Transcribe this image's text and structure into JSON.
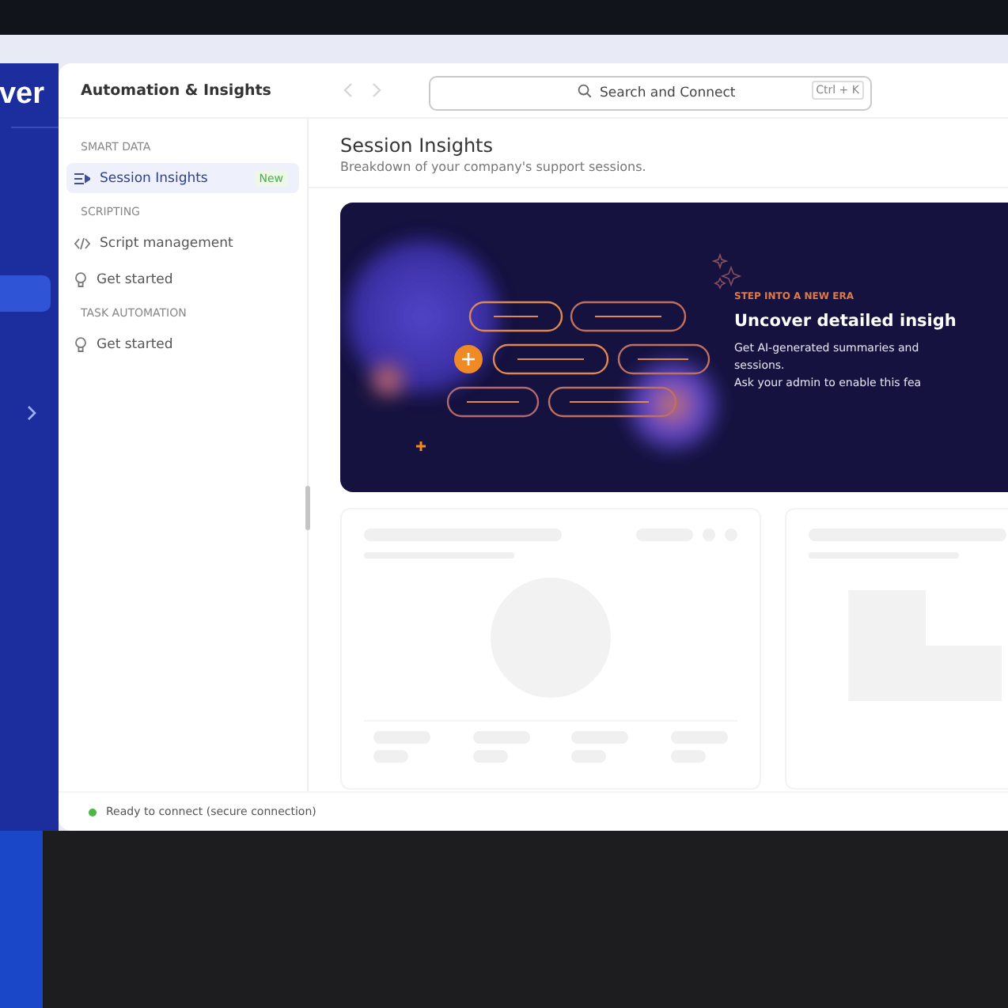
{
  "rail": {
    "logo": "ver"
  },
  "window": {
    "title": "Automation & Insights"
  },
  "search": {
    "placeholder": "Search and Connect",
    "shortcut": "Ctrl + K"
  },
  "sidebar": {
    "sections": [
      {
        "heading": "SMART DATA",
        "items": [
          {
            "kind": "list",
            "label": "Session Insights",
            "badge": "New",
            "selected": true
          }
        ]
      },
      {
        "heading": "SCRIPTING",
        "items": [
          {
            "kind": "code",
            "label": "Script management",
            "selected": false
          },
          {
            "kind": "bulb",
            "label": "Get started",
            "selected": false
          }
        ]
      },
      {
        "heading": "TASK AUTOMATION",
        "items": [
          {
            "kind": "bulb",
            "label": "Get started",
            "selected": false
          }
        ]
      }
    ]
  },
  "page": {
    "title": "Session Insights",
    "subtitle": "Breakdown of your company's support sessions."
  },
  "banner": {
    "eyebrow": "STEP INTO A NEW ERA",
    "title": "Uncover detailed insigh",
    "lines": [
      "Get AI-generated summaries and",
      "sessions.",
      "Ask your admin to enable this fea"
    ]
  },
  "status_bar": {
    "text": "Ready to connect (secure connection)"
  }
}
